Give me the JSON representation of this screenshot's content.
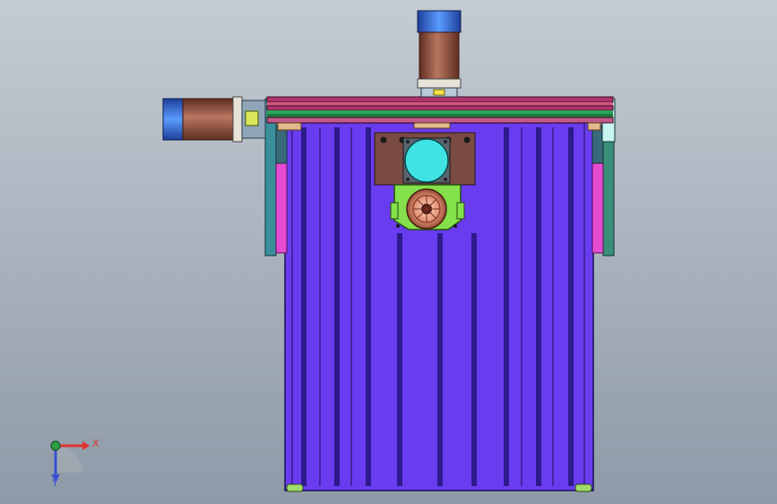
{
  "viewport": {
    "background_top": "#c4cbd3",
    "background_bottom": "#8e9aa8"
  },
  "triad": {
    "x_label": "X",
    "y_label": "Y",
    "x_color": "#e0332c",
    "y_color": "#3a4fd0",
    "origin_color": "#2ea043"
  },
  "model": {
    "frame_color": "#6a3cf0",
    "slot_color": "#2d1a8c",
    "rail_color": "#b0356b",
    "side_panel_color": "#e64bd2",
    "plate_color": "#7a4b43",
    "gear_housing_color": "#84e04b",
    "motor_body_color": "#8b4e3b",
    "motor_band_color": "#2f6fd6",
    "cyan_disk_color": "#3fe3e3",
    "icons": [
      "top-motor-icon",
      "side-motor-icon",
      "gearbox-icon",
      "pulley-icon"
    ]
  }
}
